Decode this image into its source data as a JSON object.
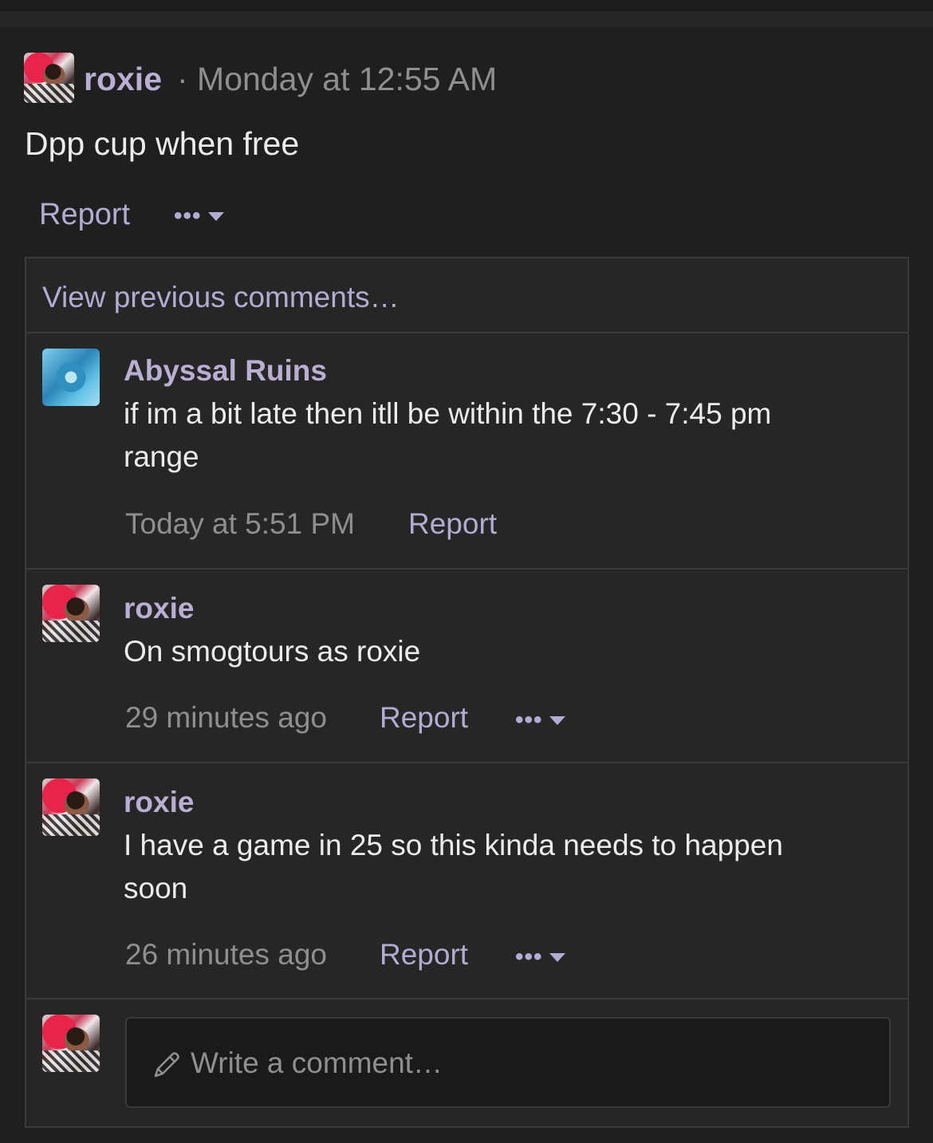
{
  "post": {
    "author": "roxie",
    "timestamp": "· Monday at 12:55 AM",
    "body": "Dpp cup when free",
    "report_label": "Report",
    "more_label": "•••"
  },
  "comments_section": {
    "view_previous_label": "View previous comments…",
    "comments": [
      {
        "author": "Abyssal Ruins",
        "text": "if im a bit late then itll be within the 7:30 - 7:45 pm range",
        "time": "Today at 5:51 PM",
        "report_label": "Report"
      },
      {
        "author": "roxie",
        "text": "On smogtours as roxie",
        "time": "29 minutes ago",
        "report_label": "Report",
        "more_label": "•••"
      },
      {
        "author": "roxie",
        "text": "I have a game in 25 so this kinda needs to happen soon",
        "time": "26 minutes ago",
        "report_label": "Report",
        "more_label": "•••"
      }
    ],
    "write_comment_placeholder": "Write a comment…"
  },
  "icons": {
    "more": "ellipsis-icon",
    "caret": "caret-down-icon",
    "pencil": "pencil-icon"
  },
  "colors": {
    "background": "#1f1f1f",
    "panel": "#262626",
    "link": "#b3acd2",
    "muted": "#8f8f8f",
    "text": "#ececec"
  }
}
